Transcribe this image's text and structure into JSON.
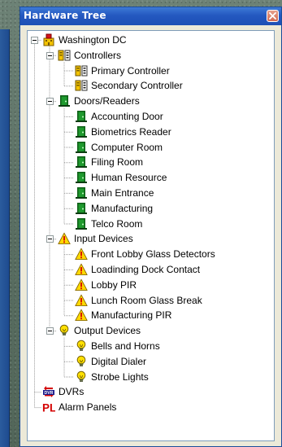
{
  "window": {
    "title": "Hardware Tree"
  },
  "colors": {
    "title_bar": "#2458c0",
    "close_button": "#d36b52",
    "warning_yellow": "#ffd800",
    "door_green": "#1f9a2e",
    "controller_yellow": "#f2c200",
    "alarm_red": "#d40000"
  },
  "tree": {
    "root": {
      "label": "Washington DC",
      "icon": "building-icon",
      "expanded": true
    },
    "groups": [
      {
        "label": "Controllers",
        "icon": "controller-icon",
        "expanded": true,
        "items": [
          {
            "label": "Primary Controller",
            "icon": "controller-icon"
          },
          {
            "label": "Secondary Controller",
            "icon": "controller-icon"
          }
        ]
      },
      {
        "label": "Doors/Readers",
        "icon": "door-icon",
        "expanded": true,
        "items": [
          {
            "label": "Accounting Door",
            "icon": "door-icon"
          },
          {
            "label": "Biometrics Reader",
            "icon": "door-icon"
          },
          {
            "label": "Computer Room",
            "icon": "door-icon"
          },
          {
            "label": "Filing Room",
            "icon": "door-icon"
          },
          {
            "label": "Human Resource",
            "icon": "door-icon"
          },
          {
            "label": "Main Entrance",
            "icon": "door-icon"
          },
          {
            "label": "Manufacturing",
            "icon": "door-icon"
          },
          {
            "label": "Telco Room",
            "icon": "door-icon"
          }
        ]
      },
      {
        "label": "Input Devices",
        "icon": "warning-icon",
        "expanded": true,
        "items": [
          {
            "label": "Front Lobby Glass Detectors",
            "icon": "warning-icon"
          },
          {
            "label": "Loadinding Dock Contact",
            "icon": "warning-icon"
          },
          {
            "label": "Lobby PIR",
            "icon": "warning-icon"
          },
          {
            "label": "Lunch Room Glass Break",
            "icon": "warning-icon"
          },
          {
            "label": "Manufacturing PIR",
            "icon": "warning-icon"
          }
        ]
      },
      {
        "label": "Output Devices",
        "icon": "bulb-icon",
        "expanded": true,
        "items": [
          {
            "label": "Bells and Horns",
            "icon": "bulb-icon"
          },
          {
            "label": "Digital Dialer",
            "icon": "bulb-icon"
          },
          {
            "label": "Strobe Lights",
            "icon": "bulb-icon"
          }
        ]
      }
    ],
    "leaves": [
      {
        "label": "DVRs",
        "icon": "dvr-icon",
        "icon_text": "DVR"
      },
      {
        "label": "Alarm Panels",
        "icon": "alarm-panel-icon",
        "icon_text": "PL"
      }
    ]
  }
}
